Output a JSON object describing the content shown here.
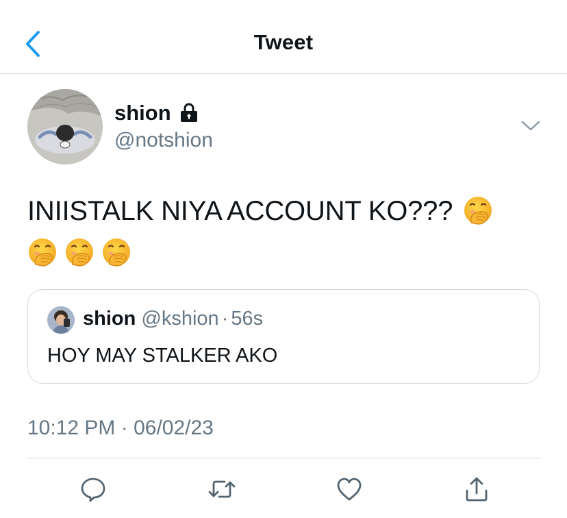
{
  "header": {
    "title": "Tweet",
    "back_icon": "chevron-left-icon"
  },
  "author": {
    "name": "shion",
    "handle": "@notshion",
    "protected_icon": "lock-icon",
    "menu_icon": "chevron-down-icon"
  },
  "tweet": {
    "text": "INIISTALK NIYA ACCOUNT KO???",
    "emoji": "face-with-hand-over-mouth",
    "emoji_count": 4
  },
  "quote": {
    "name": "shion",
    "handle": "@kshion",
    "separator": "·",
    "age": "56s",
    "text": "HOY MAY STALKER AKO"
  },
  "timestamp": "10:12 PM · 06/02/23",
  "actions": {
    "reply_icon": "reply-icon",
    "retweet_icon": "retweet-icon",
    "like_icon": "heart-icon",
    "share_icon": "share-icon"
  },
  "colors": {
    "accent": "#1d9bf0",
    "secondary_text": "#657786",
    "border": "#d6d6d9"
  }
}
